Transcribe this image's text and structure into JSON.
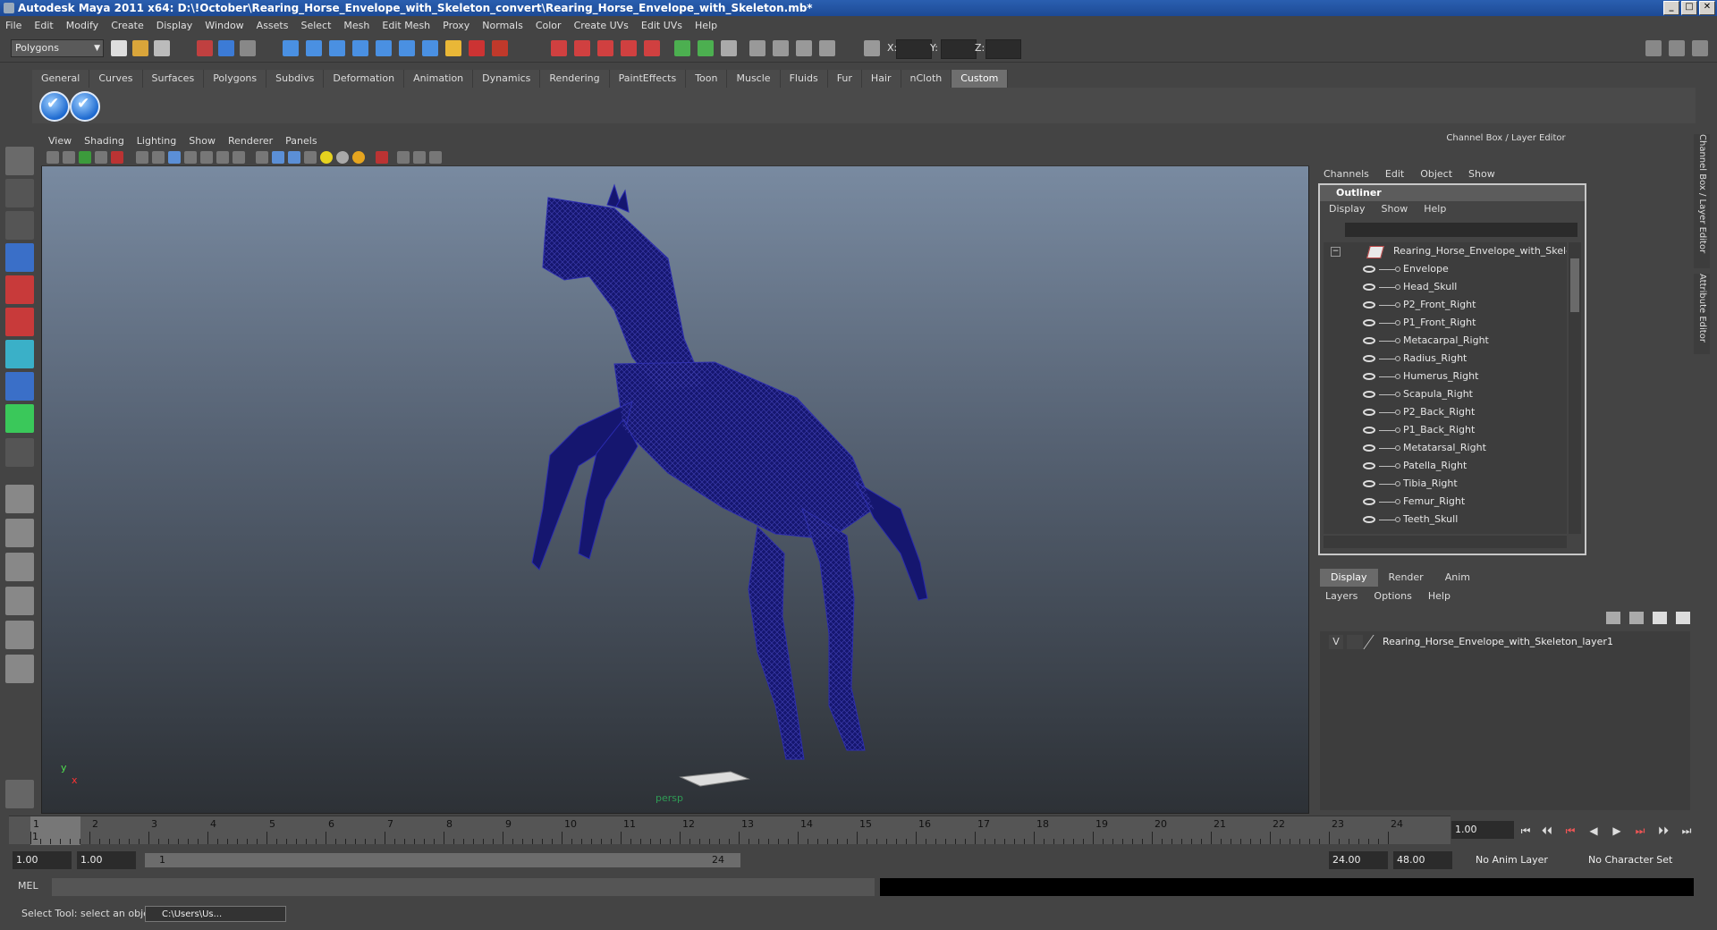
{
  "window": {
    "title": "Autodesk Maya 2011 x64: D:\\!October\\Rearing_Horse_Envelope_with_Skeleton_convert\\Rearing_Horse_Envelope_with_Skeleton.mb*",
    "minimize": "_",
    "maximize": "□",
    "close": "✕"
  },
  "menubar": [
    "File",
    "Edit",
    "Modify",
    "Create",
    "Display",
    "Window",
    "Assets",
    "Select",
    "Mesh",
    "Edit Mesh",
    "Proxy",
    "Normals",
    "Color",
    "Create UVs",
    "Edit UVs",
    "Help"
  ],
  "statusline": {
    "mode": "Polygons",
    "x_label": "X:",
    "y_label": "Y:",
    "z_label": "Z:"
  },
  "shelf_tabs": [
    "General",
    "Curves",
    "Surfaces",
    "Polygons",
    "Subdivs",
    "Deformation",
    "Animation",
    "Dynamics",
    "Rendering",
    "PaintEffects",
    "Toon",
    "Muscle",
    "Fluids",
    "Fur",
    "Hair",
    "nCloth",
    "Custom"
  ],
  "shelf_active": "Custom",
  "viewport": {
    "menu": [
      "View",
      "Shading",
      "Lighting",
      "Show",
      "Renderer",
      "Panels"
    ],
    "camera": "persp",
    "axis_y": "y",
    "axis_x": "x",
    "wire_color": "#17187a"
  },
  "channel_box": {
    "title": "Channel Box / Layer Editor",
    "menu": [
      "Channels",
      "Edit",
      "Object",
      "Show"
    ],
    "side_tabs": [
      "Channel Box / Layer Editor",
      "Attribute Editor"
    ]
  },
  "outliner": {
    "title": "Outliner",
    "menu": [
      "Display",
      "Show",
      "Help"
    ],
    "root": "Rearing_Horse_Envelope_with_Skeleton",
    "items": [
      "Envelope",
      "Head_Skull",
      "P2_Front_Right",
      "P1_Front_Right",
      "Metacarpal_Right",
      "Radius_Right",
      "Humerus_Right",
      "Scapula_Right",
      "P2_Back_Right",
      "P1_Back_Right",
      "Metatarsal_Right",
      "Patella_Right",
      "Tibia_Right",
      "Femur_Right",
      "Teeth_Skull"
    ]
  },
  "layer_editor": {
    "tabs": [
      "Display",
      "Render",
      "Anim"
    ],
    "active_tab": "Display",
    "menu": [
      "Layers",
      "Options",
      "Help"
    ],
    "layer": {
      "visible": "V",
      "name": "Rearing_Horse_Envelope_with_Skeleton_layer1"
    }
  },
  "timeline": {
    "ticks": [
      "1",
      "2",
      "3",
      "4",
      "5",
      "6",
      "7",
      "8",
      "9",
      "10",
      "11",
      "12",
      "13",
      "14",
      "15",
      "16",
      "17",
      "18",
      "19",
      "20",
      "21",
      "22",
      "23",
      "24"
    ],
    "current_frame_marker": "1",
    "current_frame": "1.00",
    "playback_buttons": [
      "⏮",
      "⏴⏴",
      "⏮",
      "◀",
      "▶",
      "⏭",
      "⏵⏵",
      "⏭"
    ]
  },
  "range": {
    "start": "1.00",
    "playback_start": "1.00",
    "slider_start": "1",
    "slider_end": "24",
    "playback_end": "24.00",
    "end": "48.00",
    "anim_layer": "No Anim Layer",
    "character_set": "No Character Set"
  },
  "command_line": {
    "label": "MEL"
  },
  "help_line": {
    "text": "Select Tool: select an object",
    "task_button": "C:\\Users\\Us..."
  }
}
